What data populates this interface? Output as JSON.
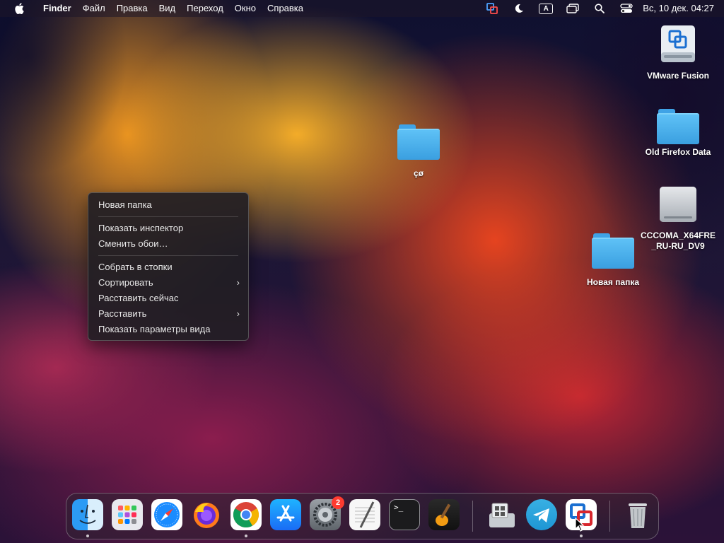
{
  "menubar": {
    "app_name": "Finder",
    "menus": [
      "Файл",
      "Правка",
      "Вид",
      "Переход",
      "Окно",
      "Справка"
    ],
    "tray": {
      "keyboard_layout": "A",
      "clock": "Вс, 10 дек.  04:27"
    }
  },
  "desktop": {
    "icons": [
      {
        "label": "VMware Fusion",
        "kind": "drive-vmware-icon"
      },
      {
        "label": "Old Firefox Data",
        "kind": "folder-icon"
      },
      {
        "label": "CCCOMA_X64FRE_RU-RU_DV9",
        "kind": "disk-drive-icon"
      },
      {
        "label": "Новая папка",
        "kind": "folder-icon"
      },
      {
        "label": "çø",
        "kind": "folder-icon"
      }
    ]
  },
  "context_menu": {
    "items": [
      {
        "label": "Новая папка"
      },
      {
        "label": "Показать инспектор"
      },
      {
        "label": "Сменить обои…"
      },
      {
        "label": "Собрать в стопки"
      },
      {
        "label": "Сортировать",
        "submenu_arrow": "›"
      },
      {
        "label": "Расставить сейчас"
      },
      {
        "label": "Расставить",
        "submenu_arrow": "›"
      },
      {
        "label": "Показать параметры вида"
      }
    ]
  },
  "dock": {
    "apps": [
      {
        "name": "finder-icon",
        "running": true
      },
      {
        "name": "launchpad-icon",
        "running": false
      },
      {
        "name": "safari-icon",
        "running": false
      },
      {
        "name": "firefox-icon",
        "running": false
      },
      {
        "name": "chrome-icon",
        "running": true
      },
      {
        "name": "app-store-icon",
        "running": false
      },
      {
        "name": "system-settings-icon",
        "running": false,
        "badge": "2"
      },
      {
        "name": "textedit-icon",
        "running": false
      },
      {
        "name": "terminal-icon",
        "running": false
      },
      {
        "name": "garageband-icon",
        "running": false
      },
      {
        "name": "boot-camp-icon",
        "running": false
      },
      {
        "name": "telegram-icon",
        "running": false
      },
      {
        "name": "vmware-fusion-icon",
        "running": true
      },
      {
        "name": "trash-icon",
        "running": false
      }
    ],
    "terminal_prompt": ">_"
  },
  "colors": {
    "folder_blue": "#4bb2ef",
    "badge_red": "#ff3b30",
    "menu_bg": "#221e24"
  }
}
